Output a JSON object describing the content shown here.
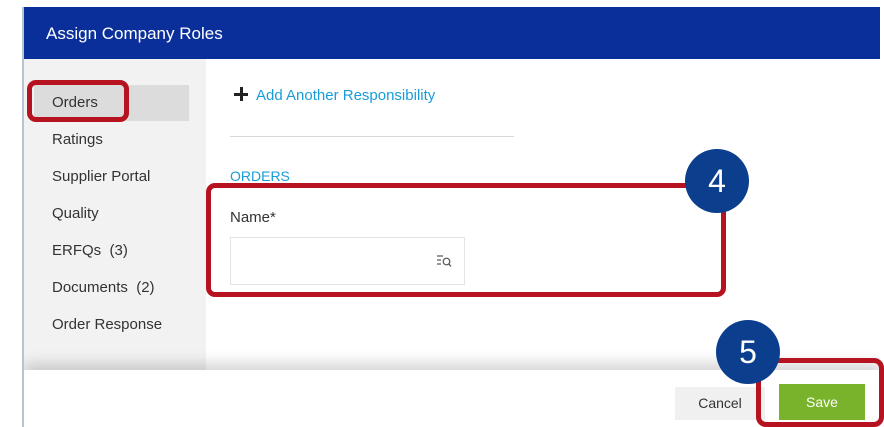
{
  "dialog": {
    "title": "Assign Company Roles"
  },
  "sidebar": {
    "items": [
      {
        "label": "Orders",
        "active": true
      },
      {
        "label": "Ratings"
      },
      {
        "label": "Supplier Portal"
      },
      {
        "label": "Quality"
      },
      {
        "label": "ERFQs  (3)"
      },
      {
        "label": "Documents  (2)"
      },
      {
        "label": "Order Response"
      }
    ]
  },
  "main": {
    "add_responsibility_label": "Add Another Responsibility",
    "section_title": "ORDERS",
    "name_field": {
      "label": "Name*",
      "value": "",
      "placeholder": ""
    }
  },
  "footer": {
    "cancel_label": "Cancel",
    "save_label": "Save"
  },
  "annotations": {
    "step_4": "4",
    "step_5": "5"
  },
  "colors": {
    "titlebar": "#0b2f9a",
    "accent_link": "#1a9cd8",
    "save": "#79b32b",
    "highlight": "#b7121f",
    "step_badge": "#0b3f8d"
  },
  "icons": {
    "add": "plus-icon",
    "lookup": "list-search-icon"
  }
}
